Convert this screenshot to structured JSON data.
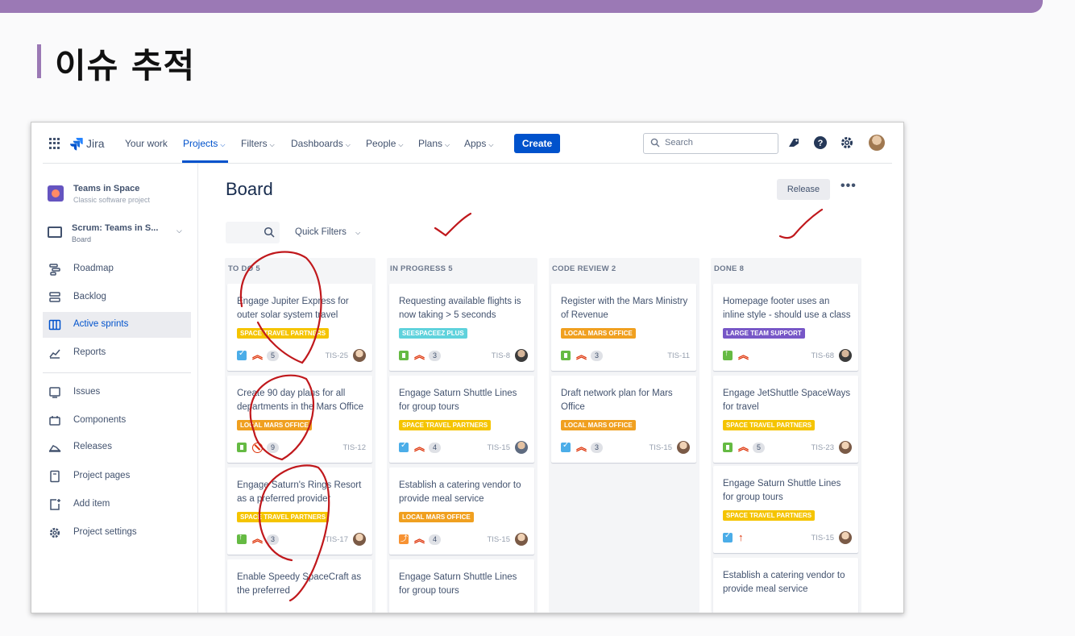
{
  "slide": {
    "title": "이슈 추적"
  },
  "nav": {
    "brand": "Jira",
    "items": [
      {
        "label": "Your work",
        "dropdown": false,
        "active": false
      },
      {
        "label": "Projects",
        "dropdown": true,
        "active": true
      },
      {
        "label": "Filters",
        "dropdown": true,
        "active": false
      },
      {
        "label": "Dashboards",
        "dropdown": true,
        "active": false
      },
      {
        "label": "People",
        "dropdown": true,
        "active": false
      },
      {
        "label": "Plans",
        "dropdown": true,
        "active": false
      },
      {
        "label": "Apps",
        "dropdown": true,
        "active": false
      }
    ],
    "create_label": "Create",
    "search_placeholder": "Search"
  },
  "sidebar": {
    "project_name": "Teams in Space",
    "project_type": "Classic software project",
    "board_name": "Scrum: Teams in S...",
    "board_sub": "Board",
    "items": [
      {
        "label": "Roadmap",
        "icon": "roadmap-icon",
        "active": false
      },
      {
        "label": "Backlog",
        "icon": "backlog-icon",
        "active": false
      },
      {
        "label": "Active sprints",
        "icon": "board-icon",
        "active": true
      },
      {
        "label": "Reports",
        "icon": "reports-icon",
        "active": false
      },
      {
        "label": "Issues",
        "icon": "issues-icon",
        "active": false
      },
      {
        "label": "Components",
        "icon": "components-icon",
        "active": false
      },
      {
        "label": "Releases",
        "icon": "releases-icon",
        "active": false
      },
      {
        "label": "Project pages",
        "icon": "pages-icon",
        "active": false
      },
      {
        "label": "Add item",
        "icon": "add-item-icon",
        "active": false
      },
      {
        "label": "Project settings",
        "icon": "settings-icon",
        "active": false
      }
    ]
  },
  "board": {
    "title": "Board",
    "release_label": "Release",
    "more_label": "•••",
    "quick_filters_label": "Quick Filters",
    "colors": {
      "space_travel": "#f5c400",
      "local_mars": "#f0a020",
      "seespaceez": "#5fd2dc",
      "large_team": "#7757c7"
    },
    "columns": [
      {
        "name": "TO DO",
        "count": "5",
        "cards": [
          {
            "title": "Engage Jupiter Express for outer solar system travel",
            "tag": "SPACE TRAVEL PARTNERS",
            "tag_color": "#f5c400",
            "type": "task",
            "priority": "high",
            "points": "5",
            "key": "TIS-25",
            "avatar": "av1"
          },
          {
            "title": "Create 90 day plans for all departments in the Mars Office",
            "tag": "LOCAL MARS OFFICE",
            "tag_color": "#f0a020",
            "type": "story",
            "priority": "blocker",
            "points": "9",
            "key": "TIS-12",
            "avatar": ""
          },
          {
            "title": "Engage Saturn's Rings Resort as a preferred provider",
            "tag": "SPACE TRAVEL PARTNERS",
            "tag_color": "#f5c400",
            "type": "improve",
            "priority": "high",
            "points": "3",
            "key": "TIS-17",
            "avatar": "av1"
          },
          {
            "title": "Enable Speedy SpaceCraft as the preferred",
            "tag": "",
            "tag_color": "",
            "type": "",
            "priority": "",
            "points": "",
            "key": "",
            "avatar": ""
          }
        ]
      },
      {
        "name": "IN PROGRESS",
        "count": "5",
        "cards": [
          {
            "title": "Requesting available flights is now taking > 5 seconds",
            "tag": "SEESPACEEZ PLUS",
            "tag_color": "#5fd2dc",
            "type": "story",
            "priority": "high",
            "points": "3",
            "key": "TIS-8",
            "avatar": "av2"
          },
          {
            "title": "Engage Saturn Shuttle Lines for group tours",
            "tag": "SPACE TRAVEL PARTNERS",
            "tag_color": "#f5c400",
            "type": "task",
            "priority": "high",
            "points": "4",
            "key": "TIS-15",
            "avatar": "av3"
          },
          {
            "title": "Establish a catering vendor to provide meal service",
            "tag": "LOCAL MARS OFFICE",
            "tag_color": "#f0a020",
            "type": "sub",
            "priority": "high",
            "points": "4",
            "key": "TIS-15",
            "avatar": "av1"
          },
          {
            "title": "Engage Saturn Shuttle Lines for group tours",
            "tag": "",
            "tag_color": "",
            "type": "",
            "priority": "",
            "points": "",
            "key": "",
            "avatar": ""
          }
        ]
      },
      {
        "name": "CODE REVIEW",
        "count": "2",
        "cards": [
          {
            "title": "Register with the Mars Ministry of Revenue",
            "tag": "LOCAL MARS OFFICE",
            "tag_color": "#f0a020",
            "type": "story",
            "priority": "high",
            "points": "3",
            "key": "TIS-11",
            "avatar": ""
          },
          {
            "title": "Draft network plan for Mars Office",
            "tag": "LOCAL MARS OFFICE",
            "tag_color": "#f0a020",
            "type": "task",
            "priority": "high",
            "points": "3",
            "key": "TIS-15",
            "avatar": "av1"
          }
        ]
      },
      {
        "name": "DONE",
        "count": "8",
        "cards": [
          {
            "title": "Homepage footer uses an inline style - should use a class",
            "tag": "LARGE TEAM SUPPORT",
            "tag_color": "#7757c7",
            "type": "improve",
            "priority": "high",
            "points": "",
            "key": "TIS-68",
            "avatar": "av2"
          },
          {
            "title": "Engage JetShuttle SpaceWays for travel",
            "tag": "SPACE TRAVEL PARTNERS",
            "tag_color": "#f5c400",
            "type": "story",
            "priority": "high",
            "points": "5",
            "key": "TIS-23",
            "avatar": "av1"
          },
          {
            "title": "Engage Saturn Shuttle Lines for group tours",
            "tag": "SPACE TRAVEL PARTNERS",
            "tag_color": "#f5c400",
            "type": "task",
            "priority": "medium-high",
            "points": "",
            "key": "TIS-15",
            "avatar": "av1"
          },
          {
            "title": "Establish a catering vendor to provide meal service",
            "tag": "",
            "tag_color": "",
            "type": "",
            "priority": "",
            "points": "",
            "key": "",
            "avatar": ""
          }
        ]
      }
    ]
  }
}
